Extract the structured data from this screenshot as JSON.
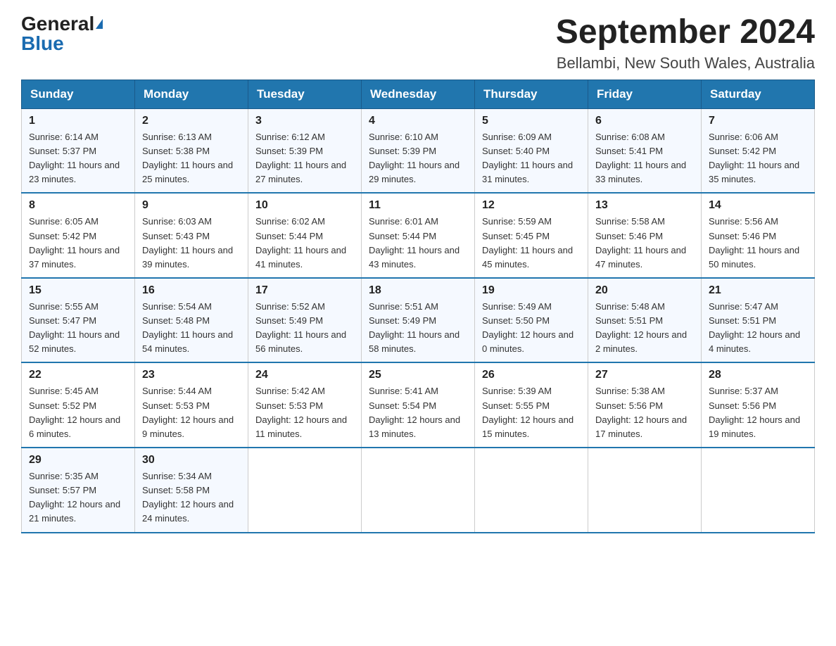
{
  "header": {
    "logo_general": "General",
    "logo_blue": "Blue",
    "title": "September 2024",
    "subtitle": "Bellambi, New South Wales, Australia"
  },
  "days_of_week": [
    "Sunday",
    "Monday",
    "Tuesday",
    "Wednesday",
    "Thursday",
    "Friday",
    "Saturday"
  ],
  "weeks": [
    [
      {
        "day": "1",
        "sunrise": "6:14 AM",
        "sunset": "5:37 PM",
        "daylight": "11 hours and 23 minutes."
      },
      {
        "day": "2",
        "sunrise": "6:13 AM",
        "sunset": "5:38 PM",
        "daylight": "11 hours and 25 minutes."
      },
      {
        "day": "3",
        "sunrise": "6:12 AM",
        "sunset": "5:39 PM",
        "daylight": "11 hours and 27 minutes."
      },
      {
        "day": "4",
        "sunrise": "6:10 AM",
        "sunset": "5:39 PM",
        "daylight": "11 hours and 29 minutes."
      },
      {
        "day": "5",
        "sunrise": "6:09 AM",
        "sunset": "5:40 PM",
        "daylight": "11 hours and 31 minutes."
      },
      {
        "day": "6",
        "sunrise": "6:08 AM",
        "sunset": "5:41 PM",
        "daylight": "11 hours and 33 minutes."
      },
      {
        "day": "7",
        "sunrise": "6:06 AM",
        "sunset": "5:42 PM",
        "daylight": "11 hours and 35 minutes."
      }
    ],
    [
      {
        "day": "8",
        "sunrise": "6:05 AM",
        "sunset": "5:42 PM",
        "daylight": "11 hours and 37 minutes."
      },
      {
        "day": "9",
        "sunrise": "6:03 AM",
        "sunset": "5:43 PM",
        "daylight": "11 hours and 39 minutes."
      },
      {
        "day": "10",
        "sunrise": "6:02 AM",
        "sunset": "5:44 PM",
        "daylight": "11 hours and 41 minutes."
      },
      {
        "day": "11",
        "sunrise": "6:01 AM",
        "sunset": "5:44 PM",
        "daylight": "11 hours and 43 minutes."
      },
      {
        "day": "12",
        "sunrise": "5:59 AM",
        "sunset": "5:45 PM",
        "daylight": "11 hours and 45 minutes."
      },
      {
        "day": "13",
        "sunrise": "5:58 AM",
        "sunset": "5:46 PM",
        "daylight": "11 hours and 47 minutes."
      },
      {
        "day": "14",
        "sunrise": "5:56 AM",
        "sunset": "5:46 PM",
        "daylight": "11 hours and 50 minutes."
      }
    ],
    [
      {
        "day": "15",
        "sunrise": "5:55 AM",
        "sunset": "5:47 PM",
        "daylight": "11 hours and 52 minutes."
      },
      {
        "day": "16",
        "sunrise": "5:54 AM",
        "sunset": "5:48 PM",
        "daylight": "11 hours and 54 minutes."
      },
      {
        "day": "17",
        "sunrise": "5:52 AM",
        "sunset": "5:49 PM",
        "daylight": "11 hours and 56 minutes."
      },
      {
        "day": "18",
        "sunrise": "5:51 AM",
        "sunset": "5:49 PM",
        "daylight": "11 hours and 58 minutes."
      },
      {
        "day": "19",
        "sunrise": "5:49 AM",
        "sunset": "5:50 PM",
        "daylight": "12 hours and 0 minutes."
      },
      {
        "day": "20",
        "sunrise": "5:48 AM",
        "sunset": "5:51 PM",
        "daylight": "12 hours and 2 minutes."
      },
      {
        "day": "21",
        "sunrise": "5:47 AM",
        "sunset": "5:51 PM",
        "daylight": "12 hours and 4 minutes."
      }
    ],
    [
      {
        "day": "22",
        "sunrise": "5:45 AM",
        "sunset": "5:52 PM",
        "daylight": "12 hours and 6 minutes."
      },
      {
        "day": "23",
        "sunrise": "5:44 AM",
        "sunset": "5:53 PM",
        "daylight": "12 hours and 9 minutes."
      },
      {
        "day": "24",
        "sunrise": "5:42 AM",
        "sunset": "5:53 PM",
        "daylight": "12 hours and 11 minutes."
      },
      {
        "day": "25",
        "sunrise": "5:41 AM",
        "sunset": "5:54 PM",
        "daylight": "12 hours and 13 minutes."
      },
      {
        "day": "26",
        "sunrise": "5:39 AM",
        "sunset": "5:55 PM",
        "daylight": "12 hours and 15 minutes."
      },
      {
        "day": "27",
        "sunrise": "5:38 AM",
        "sunset": "5:56 PM",
        "daylight": "12 hours and 17 minutes."
      },
      {
        "day": "28",
        "sunrise": "5:37 AM",
        "sunset": "5:56 PM",
        "daylight": "12 hours and 19 minutes."
      }
    ],
    [
      {
        "day": "29",
        "sunrise": "5:35 AM",
        "sunset": "5:57 PM",
        "daylight": "12 hours and 21 minutes."
      },
      {
        "day": "30",
        "sunrise": "5:34 AM",
        "sunset": "5:58 PM",
        "daylight": "12 hours and 24 minutes."
      },
      null,
      null,
      null,
      null,
      null
    ]
  ],
  "labels": {
    "sunrise": "Sunrise:",
    "sunset": "Sunset:",
    "daylight": "Daylight:"
  }
}
